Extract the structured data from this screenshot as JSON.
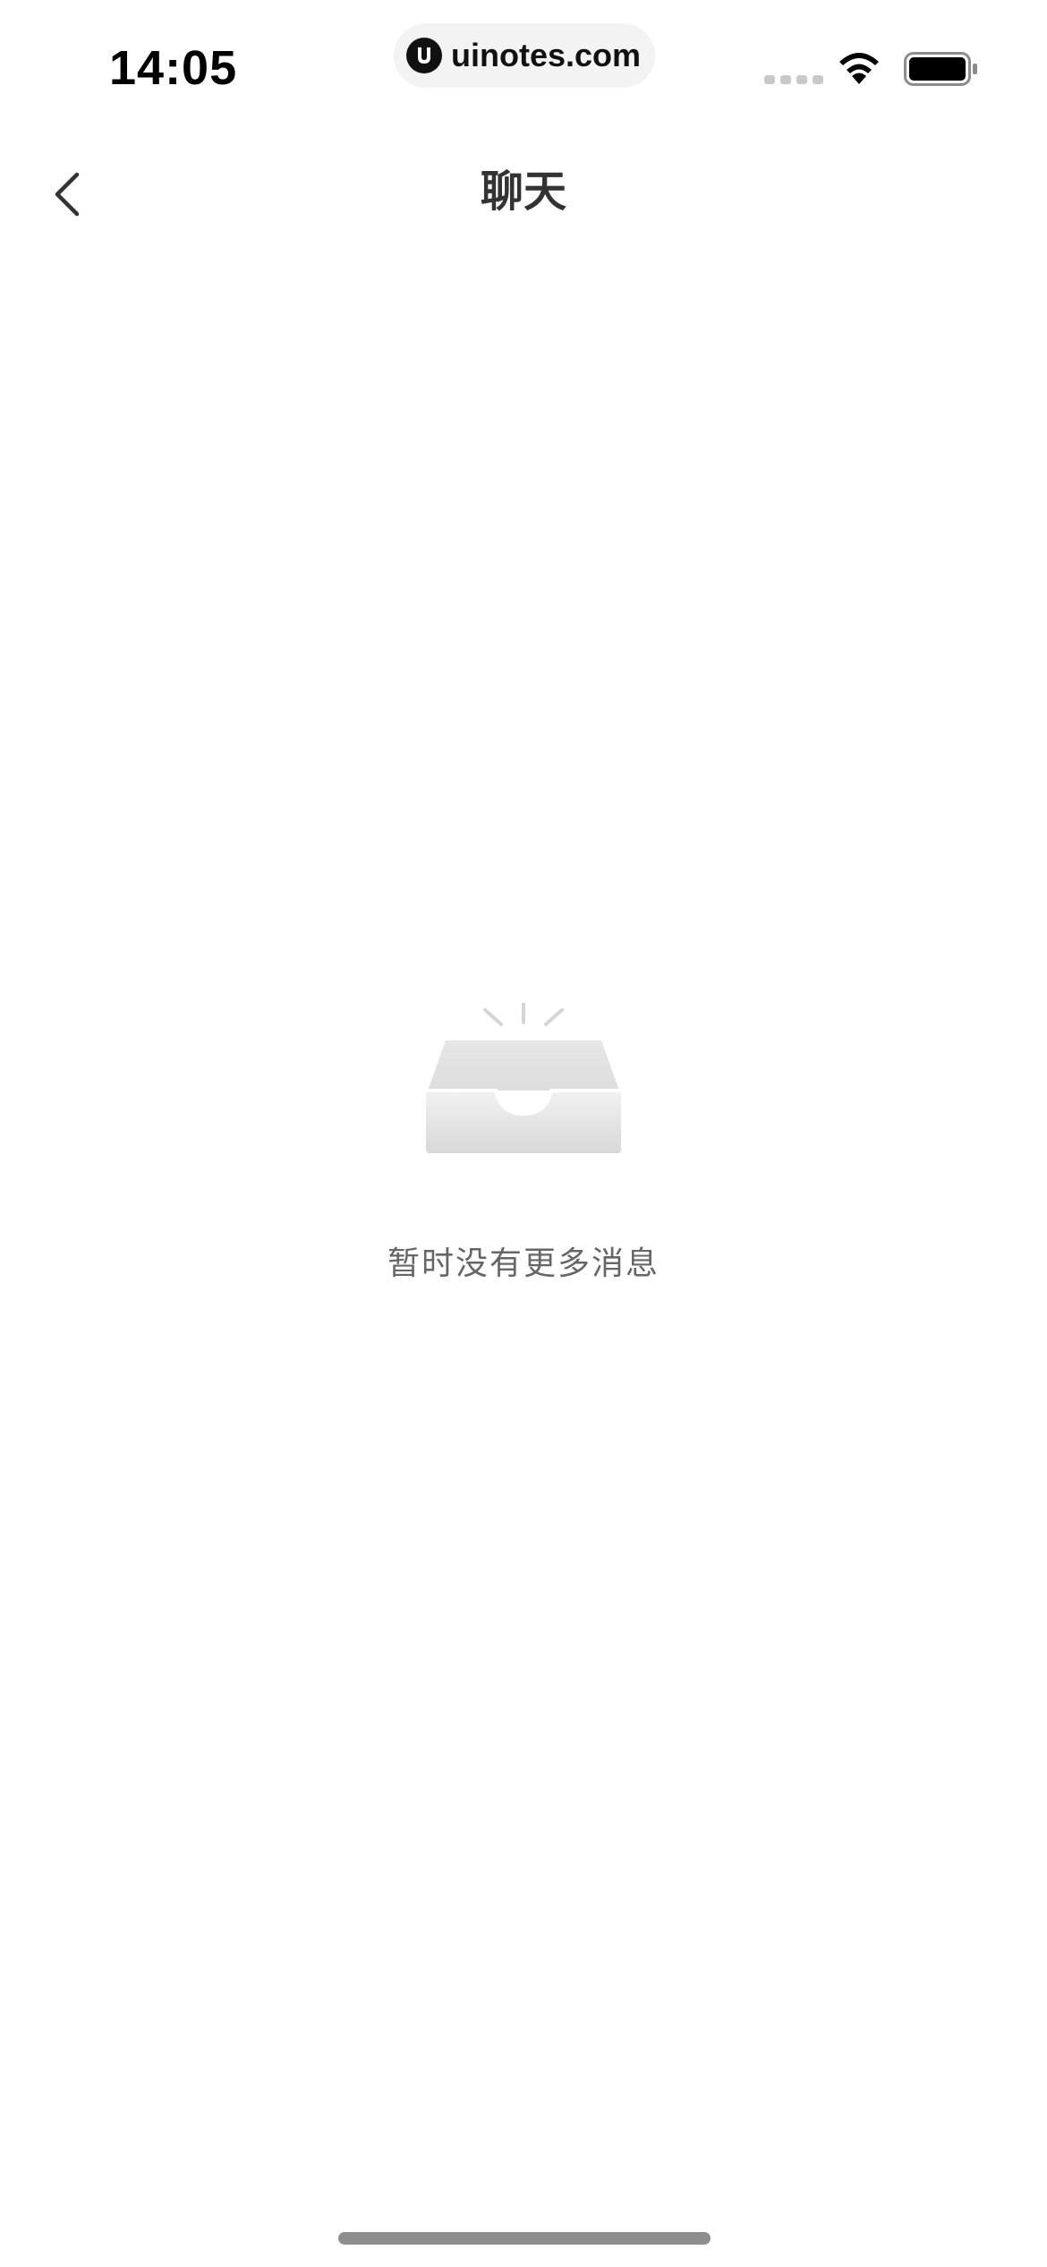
{
  "status_bar": {
    "time": "14:05",
    "url": "uinotes.com"
  },
  "nav": {
    "title": "聊天",
    "back_icon": "chevron-left-icon"
  },
  "empty_state": {
    "icon": "empty-inbox-icon",
    "message": "暂时没有更多消息"
  }
}
